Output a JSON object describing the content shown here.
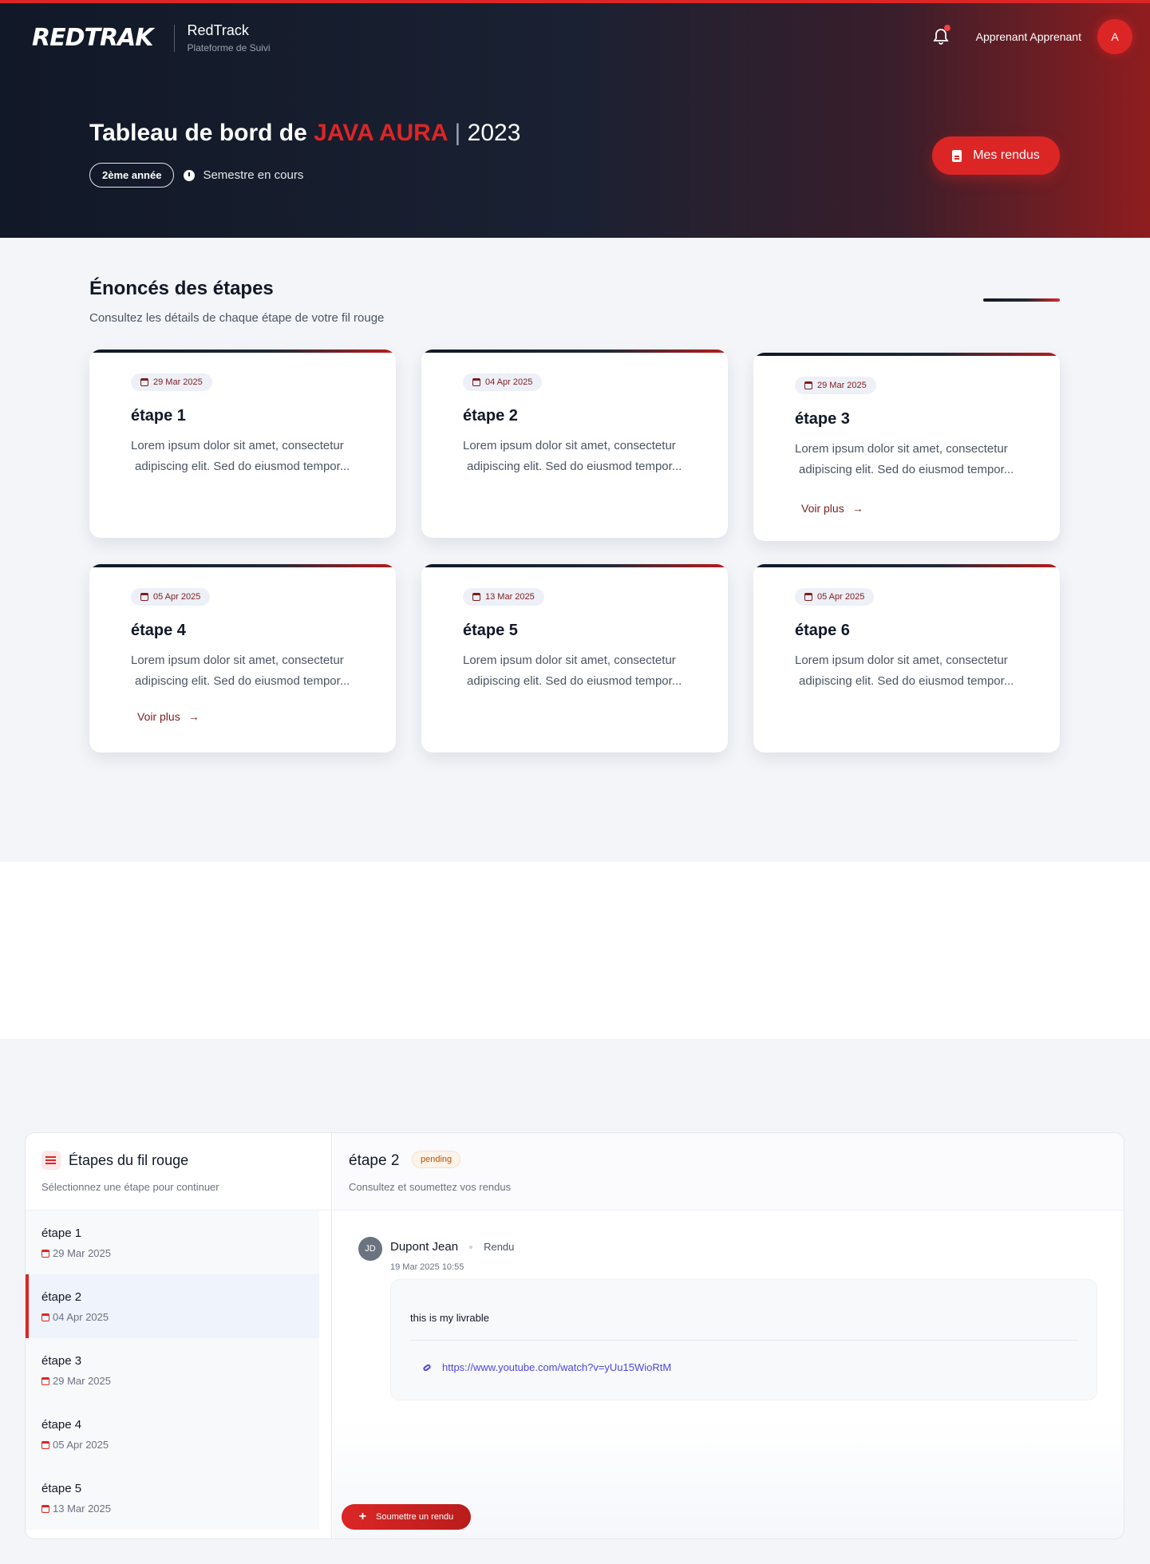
{
  "header": {
    "logo_text": "REDTRAK",
    "app_name": "RedTrack",
    "app_sub": "Plateforme de Suivi",
    "user_name": "Apprenant Apprenant",
    "avatar_initial": "A"
  },
  "hero": {
    "title_prefix": "Tableau de bord de",
    "title_highlight": "JAVA AURA",
    "separator": "|",
    "year": "2023",
    "year_badge": "2ème année",
    "semester": "Semestre en cours",
    "rendus_button": "Mes rendus"
  },
  "steps_section": {
    "title": "Énoncés des étapes",
    "subtitle": "Consultez les détails de chaque étape de votre fil rouge",
    "voir_plus": "Voir plus",
    "cards": [
      {
        "date": "29 Mar 2025",
        "title": "étape 1",
        "line1": "Lorem ipsum dolor sit amet, consectetur",
        "line2": "adipiscing elit. Sed do eiusmod tempor..."
      },
      {
        "date": "04 Apr 2025",
        "title": "étape 2",
        "line1": "Lorem ipsum dolor sit amet, consectetur",
        "line2": "adipiscing elit. Sed do eiusmod tempor..."
      },
      {
        "date": "29 Mar 2025",
        "title": "étape 3",
        "line1": "Lorem ipsum dolor sit amet, consectetur",
        "line2": "adipiscing elit. Sed do eiusmod tempor..."
      },
      {
        "date": "05 Apr 2025",
        "title": "étape 4",
        "line1": "Lorem ipsum dolor sit amet, consectetur",
        "line2": "adipiscing elit. Sed do eiusmod tempor..."
      },
      {
        "date": "13 Mar 2025",
        "title": "étape 5",
        "line1": "Lorem ipsum dolor sit amet, consectetur",
        "line2": "adipiscing elit. Sed do eiusmod tempor..."
      },
      {
        "date": "05 Apr 2025",
        "title": "étape 6",
        "line1": "Lorem ipsum dolor sit amet, consectetur",
        "line2": "adipiscing elit. Sed do eiusmod tempor..."
      }
    ]
  },
  "fil_rouge": {
    "title": "Étapes du fil rouge",
    "subtitle": "Sélectionnez une étape pour continuer",
    "steps": [
      {
        "name": "étape 1",
        "date": "29 Mar 2025"
      },
      {
        "name": "étape 2",
        "date": "04 Apr 2025"
      },
      {
        "name": "étape 3",
        "date": "29 Mar 2025"
      },
      {
        "name": "étape 4",
        "date": "05 Apr 2025"
      },
      {
        "name": "étape 5",
        "date": "13 Mar 2025"
      }
    ]
  },
  "detail": {
    "title": "étape 2",
    "status": "pending",
    "subtitle": "Consultez et soumettez vos rendus",
    "author_initials": "JD",
    "author": "Dupont Jean",
    "kind": "Rendu",
    "timestamp": "19 Mar 2025 10:55",
    "text": "this is my livrable",
    "link": "https://www.youtube.com/watch?v=yUu15WioRtM",
    "submit_label": "Soumettre un rendu"
  },
  "colors": {
    "accent": "#dc2626",
    "dark": "#111827",
    "link": "#4f46e5"
  }
}
